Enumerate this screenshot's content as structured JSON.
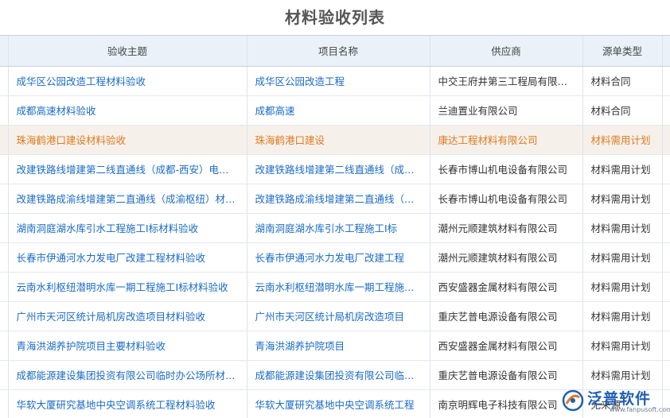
{
  "page": {
    "title": "材料验收列表"
  },
  "table": {
    "columns": [
      "验收主题",
      "项目名称",
      "供应商",
      "源单类型"
    ],
    "rows": [
      {
        "subject": "成华区公园改造工程材料验收",
        "project": "成华区公园改造工程",
        "supplier": "中交王府井第三工程局有限公司",
        "source_type": "材料合同"
      },
      {
        "subject": "成都高速材料验收",
        "project": "成都高速",
        "supplier": "兰迪置业有限公司",
        "source_type": "材料合同"
      },
      {
        "subject": "珠海鹤港口建设材料验收",
        "project": "珠海鹤港口建设",
        "supplier": "康达工程材料有限公司",
        "source_type": "材料需用计划"
      },
      {
        "subject": "改建铁路线增建第二线直通线（成都-西安）电气化工程材料验收",
        "project": "改建铁路线增建第二线直通线（成都-西安）",
        "supplier": "长春市博山机电设备有限公司",
        "source_type": "材料需用计划"
      },
      {
        "subject": "改建铁路成渝线增建第二直通线（成渝枢纽）材料验收",
        "project": "改建铁路成渝线增建第二直通线（成渝枢纽）",
        "supplier": "长春市博山机电设备有限公司",
        "source_type": "材料需用计划"
      },
      {
        "subject": "湖南洞庭湖水库引水工程施工I标材料验收",
        "project": "湖南洞庭湖水库引水工程施工I标",
        "supplier": "潮州元顺建筑材料有限公司",
        "source_type": "材料需用计划"
      },
      {
        "subject": "长春市伊通河水力发电厂改建工程材料验收",
        "project": "长春市伊通河水力发电厂改建工程",
        "supplier": "潮州元顺建筑材料有限公司",
        "source_type": "材料需用计划"
      },
      {
        "subject": "云南水利枢纽潜明水库一期工程施工I标材料验收",
        "project": "云南水利枢纽潜明水库一期工程施工I标",
        "supplier": "西安盛器金属材料有限公司",
        "source_type": "材料需用计划"
      },
      {
        "subject": "广州市天河区统计局机房改造项目材料验收",
        "project": "广州市天河区统计局机房改造项目",
        "supplier": "重庆艺普电源设备有限公司",
        "source_type": "材料需用计划"
      },
      {
        "subject": "青海洪湖养护院项目主要材料验收",
        "project": "青海洪湖养护院项目",
        "supplier": "西安盛器金属材料有限公司",
        "source_type": "材料需用计划"
      },
      {
        "subject": "成都能源建设集团投资有限公司临时办公场所材料验收",
        "project": "成都能源建设集团投资有限公司临时办公场所",
        "supplier": "重庆艺普电源设备有限公司",
        "source_type": "材料需用计划"
      },
      {
        "subject": "华软大厦研究基地中央空调系统工程材料验收",
        "project": "华软大厦研究基地中央空调系统工程",
        "supplier": "南京明辉电子科技有限公司",
        "source_type": "无来源"
      }
    ],
    "selected_row": 2
  },
  "brand": {
    "name_cn": "泛普软件",
    "name_en": "www.fanpusoft.com",
    "logo_icon": "fanpu-logo-icon",
    "primary_color": "#1f5fb0",
    "accent_color": "#e07b1f"
  }
}
